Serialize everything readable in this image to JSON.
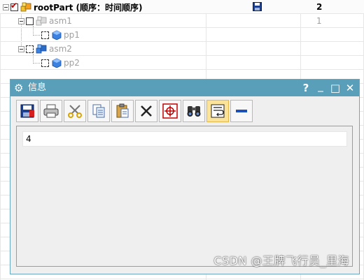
{
  "tree": {
    "rows": [
      {
        "id": "rootPart",
        "label": "rootPart (顺序：时间顺序)",
        "count": "2",
        "icon": "assembly-icon"
      },
      {
        "id": "asm1",
        "label": "asm1",
        "count": "1",
        "icon": "assembly-icon"
      },
      {
        "id": "pp1",
        "label": "pp1",
        "count": "",
        "icon": "part-icon"
      },
      {
        "id": "asm2",
        "label": "asm2",
        "count": "",
        "icon": "assembly-icon"
      },
      {
        "id": "pp2",
        "label": "pp2",
        "count": "",
        "icon": "part-icon"
      }
    ]
  },
  "dialog": {
    "title": "信息",
    "titlebar_buttons": {
      "help": "?",
      "minimize": "_",
      "maximize": "□",
      "close": "✕"
    },
    "toolbar": [
      {
        "name": "save-tool",
        "icon": "save-icon"
      },
      {
        "name": "print-tool",
        "icon": "printer-icon"
      },
      {
        "name": "cut-tool",
        "icon": "scissors-icon"
      },
      {
        "name": "copy-tool",
        "icon": "copy-icon"
      },
      {
        "name": "paste-tool",
        "icon": "paste-icon"
      },
      {
        "name": "delete-tool",
        "icon": "x-icon"
      },
      {
        "name": "locate-tool",
        "icon": "crosshair-icon"
      },
      {
        "name": "find-tool",
        "icon": "binoculars-icon"
      },
      {
        "name": "wrap-tool",
        "icon": "wrap-icon",
        "active": true
      },
      {
        "name": "collapse-tool",
        "icon": "minus-icon"
      }
    ],
    "output": {
      "lines": [
        "4"
      ]
    }
  },
  "watermark": "CSDN @王牌飞行员_里海",
  "colors": {
    "titlebar": "#5a9fba",
    "active_tool": "#fbe39a",
    "checked": "#c00000"
  }
}
